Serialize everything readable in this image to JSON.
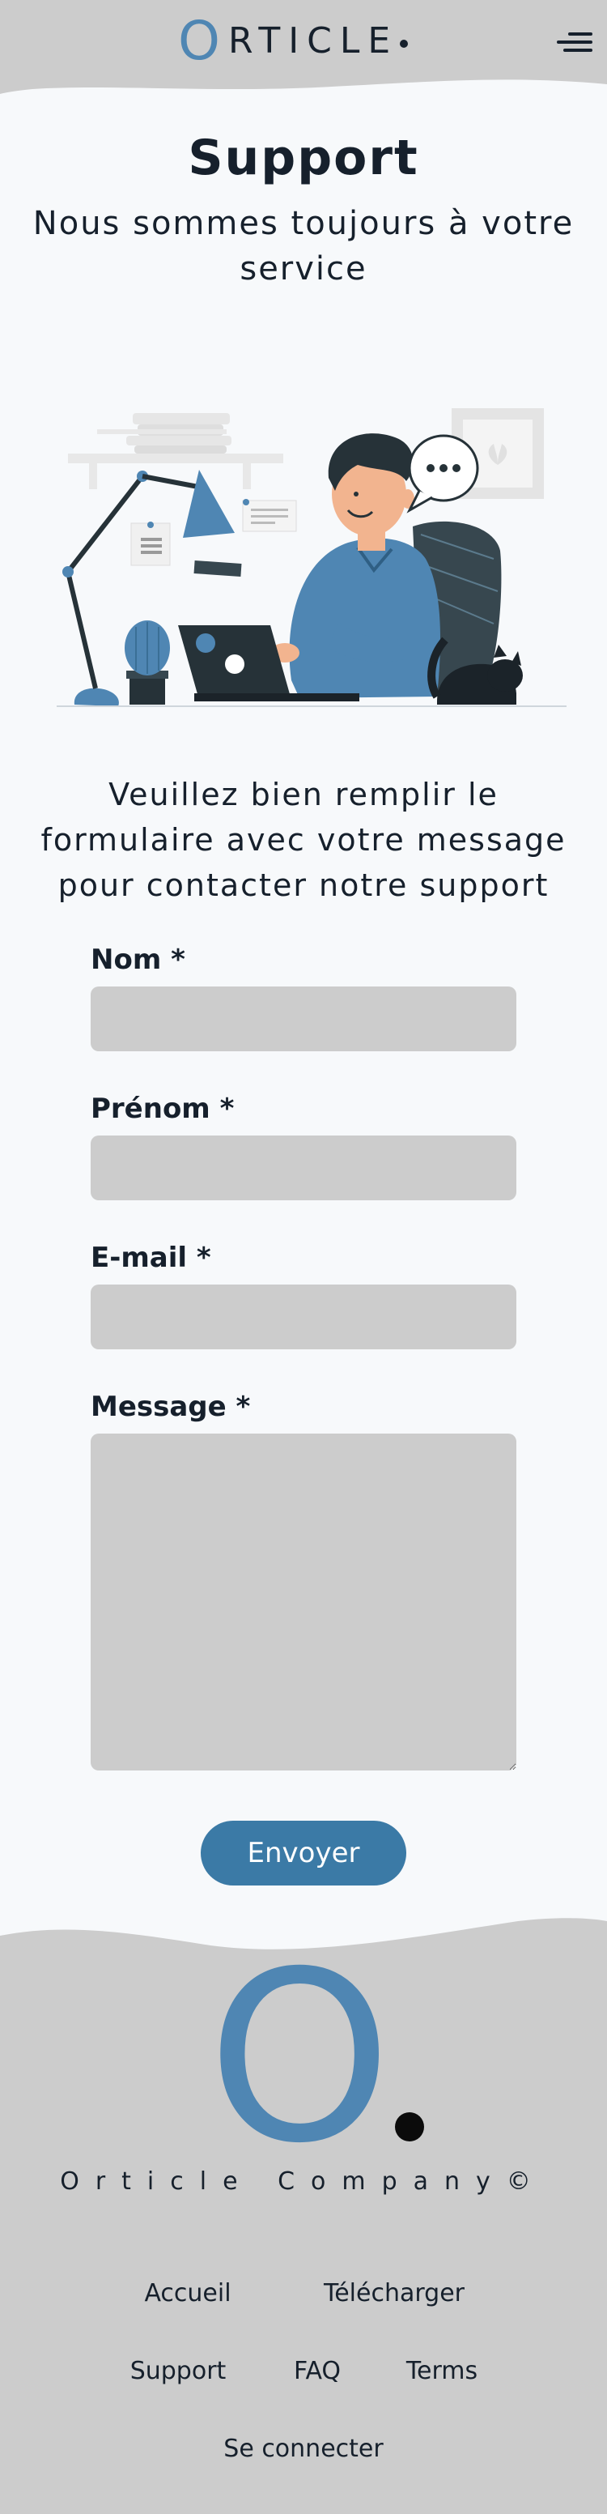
{
  "header": {
    "logo_initial": "O",
    "logo_rest": "RTICLE",
    "menu_icon": "hamburger-menu-icon"
  },
  "hero": {
    "title": "Support",
    "subtitle": "Nous sommes toujours à votre service",
    "illustration": "support-agent-illustration"
  },
  "intro": "Veuillez bien remplir le formulaire avec votre message pour contacter notre support",
  "form": {
    "nom_label": "Nom *",
    "prenom_label": "Prénom *",
    "email_label": "E-mail *",
    "message_label": "Message *",
    "nom_value": "",
    "prenom_value": "",
    "email_value": "",
    "message_value": "",
    "submit_label": "Envoyer"
  },
  "footer": {
    "logo_initial": "O",
    "company": "Orticle Company©",
    "links": {
      "accueil": "Accueil",
      "telecharger": "Télécharger",
      "support": "Support",
      "faq": "FAQ",
      "terms": "Terms",
      "se_connecter": "Se connecter"
    }
  },
  "colors": {
    "accent": "#4f86b3",
    "button": "#3b7aa6",
    "header_footer_bg": "#cccccc",
    "page_bg": "#f7f9fb",
    "input_bg": "#cccccc",
    "text": "#16202c"
  }
}
